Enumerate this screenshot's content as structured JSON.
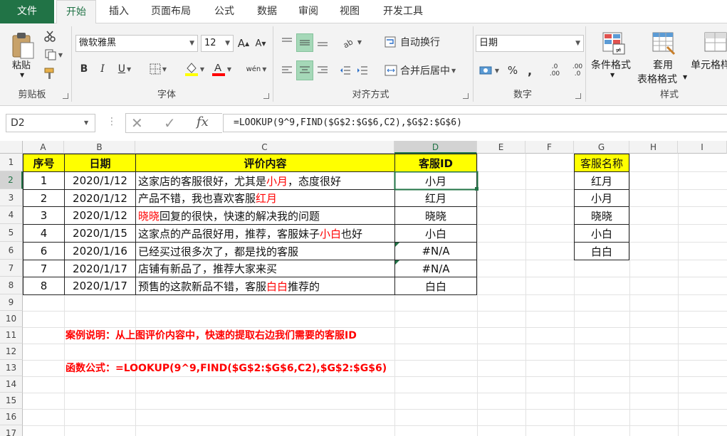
{
  "menu": {
    "tabs": [
      "文件",
      "开始",
      "插入",
      "页面布局",
      "公式",
      "数据",
      "审阅",
      "视图",
      "开发工具"
    ],
    "active_tab": "开始"
  },
  "ribbon": {
    "clipboard": {
      "paste_label": "粘贴",
      "group_label": "剪贴板"
    },
    "font": {
      "font_name": "微软雅黑",
      "font_size": "12",
      "bold": "B",
      "italic": "I",
      "underline": "U",
      "grow": "A",
      "shrink": "A",
      "group_label": "字体",
      "phonetic": "wén"
    },
    "alignment": {
      "wrap_label": "自动换行",
      "merge_label": "合并后居中",
      "group_label": "对齐方式"
    },
    "number": {
      "format": "日期",
      "percent": "%",
      "comma": ",",
      "inc_decimal": ".00",
      "dec_decimal": ".0",
      "group_label": "数字"
    },
    "styles": {
      "conditional_label": "条件格式",
      "table_label_1": "套用",
      "table_label_2": "表格格式",
      "cell_styles_label": "单元格样",
      "group_label": "样式"
    }
  },
  "formula_bar": {
    "name_box": "D2",
    "fx": "fx",
    "formula": "=LOOKUP(9^9,FIND($G$2:$G$6,C2),$G$2:$G$6)"
  },
  "grid": {
    "columns": [
      "A",
      "B",
      "C",
      "D",
      "E",
      "F",
      "G",
      "H",
      "I"
    ],
    "rows": [
      "1",
      "2",
      "3",
      "4",
      "5",
      "6",
      "7",
      "8",
      "9",
      "10",
      "11",
      "12",
      "13",
      "14",
      "15",
      "16",
      "17"
    ],
    "active_cell": "D2",
    "headers": {
      "a": "序号",
      "b": "日期",
      "c": "评价内容",
      "d": "客服ID",
      "g": "客服名称"
    },
    "records": [
      {
        "no": "1",
        "date": "2020/1/12",
        "pre": "这家店的客服很好，尤其是",
        "name": "小月",
        "post": "，态度很好",
        "id": "小月"
      },
      {
        "no": "2",
        "date": "2020/1/12",
        "pre": "产品不错，我也喜欢客服",
        "name": "红月",
        "post": "",
        "id": "红月"
      },
      {
        "no": "3",
        "date": "2020/1/12",
        "pre": "",
        "name": "晓晓",
        "post": "回复的很快，快速的解决我的问题",
        "id": "晓晓"
      },
      {
        "no": "4",
        "date": "2020/1/15",
        "pre": "这家点的产品很好用，推荐，客服妹子",
        "name": "小白",
        "post": "也好",
        "id": "小白"
      },
      {
        "no": "6",
        "date": "2020/1/16",
        "pre": "已经买过很多次了，都是找的客服",
        "name": "",
        "post": "",
        "id": "#N/A"
      },
      {
        "no": "7",
        "date": "2020/1/17",
        "pre": "店铺有新品了，推荐大家来买",
        "name": "",
        "post": "",
        "id": "#N/A"
      },
      {
        "no": "8",
        "date": "2020/1/17",
        "pre": "预售的这款新品不错，客服",
        "name": "白白",
        "post": "推荐的",
        "id": "白白"
      }
    ],
    "staff_names": [
      "红月",
      "小月",
      "晓晓",
      "小白",
      "白白"
    ],
    "note_description": "案例说明：从上图评价内容中，快速的提取右边我们需要的客服ID",
    "note_formula": "函数公式：=LOOKUP(9^9,FIND($G$2:$G$6,C2),$G$2:$G$6)"
  },
  "colors": {
    "accent": "#217346",
    "header_fill": "#ffff00",
    "highlight_text": "#ff0000"
  }
}
